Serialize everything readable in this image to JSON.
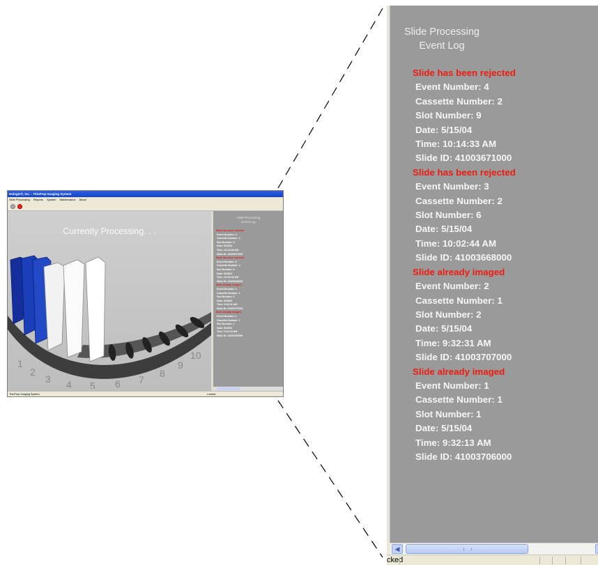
{
  "app": {
    "window_title": "Hologic®, Inc. - ThinPrep Imaging System",
    "menu": [
      "Slide Processing",
      "Reports",
      "System",
      "Maintenance",
      "About"
    ],
    "status_text": "Currently Processing. . .",
    "statusbar_left": "ThinPrep Imaging System",
    "statusbar_right": "Locked"
  },
  "carousel": {
    "slot_numbers": [
      "1",
      "2",
      "3",
      "4",
      "5",
      "6",
      "7",
      "8",
      "9",
      "10"
    ],
    "colors": {
      "blue_slide": "#1a3fb8",
      "white_slide": "#f2f2f2",
      "tray": "#3a3a3a",
      "background": "#c6c6c6"
    }
  },
  "event_log": {
    "title_line1": "Slide Processing",
    "title_line2": "Event Log",
    "entries": [
      {
        "heading": "Slide has been rejected",
        "event": "Event Number: 4",
        "cassette": "Cassette Number: 2",
        "slot": "Slot Number: 9",
        "date": "Date: 5/15/04",
        "time": "Time: 10:14:33 AM",
        "slide_id": "Slide ID: 41003671000"
      },
      {
        "heading": "Slide has been rejected",
        "event": "Event Number: 3",
        "cassette": "Cassette Number: 2",
        "slot": "Slot Number: 6",
        "date": "Date: 5/15/04",
        "time": "Time: 10:02:44 AM",
        "slide_id": "Slide ID: 41003668000"
      },
      {
        "heading": "Slide already imaged",
        "event": "Event Number: 2",
        "cassette": "Cassette Number: 1",
        "slot": "Slot Number: 2",
        "date": "Date: 5/15/04",
        "time": "Time: 9:32:31 AM",
        "slide_id": "Slide ID: 41003707000"
      },
      {
        "heading": "Slide already imaged",
        "event": "Event Number: 1",
        "cassette": "Cassette Number: 1",
        "slot": "Slot Number: 1",
        "date": "Date: 5/15/04",
        "time": "Time: 9:32:13 AM",
        "slide_id": "Slide ID: 41003706000"
      }
    ]
  },
  "zoom_status_text": "cked",
  "colors": {
    "heading_red": "#ee1b0f",
    "panel_gray": "#9a9a9a",
    "titlebar_blue": "#1f52d6"
  }
}
